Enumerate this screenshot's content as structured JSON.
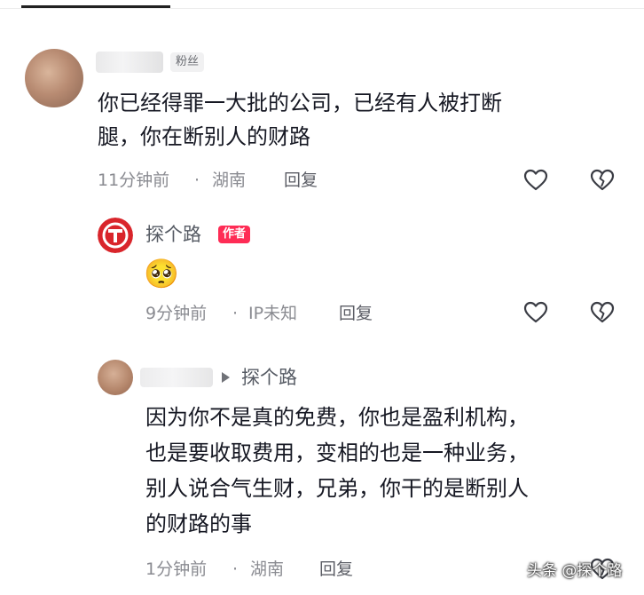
{
  "comments": [
    {
      "badge": "粉丝",
      "lines": [
        "你已经得罪一大批的公司，已经有人被打断",
        "腿，你在断别人的财路"
      ],
      "time": "11分钟前",
      "sep": "·",
      "location": "湖南",
      "reply": "回复"
    },
    {
      "name": "探个路",
      "badge": "作者",
      "emoji": "🥺",
      "time": "9分钟前",
      "sep": "·",
      "location": "IP未知",
      "reply": "回复"
    },
    {
      "reply_to": "探个路",
      "lines": [
        "因为你不是真的免费，你也是盈利机构，",
        "也是要收取费用，变相的也是一种业务，",
        "别人说合气生财，兄弟，你干的是断别人",
        "的财路的事"
      ],
      "time": "1分钟前",
      "sep": "·",
      "location": "湖南",
      "reply": "回复"
    }
  ],
  "watermark": "头条 @探个路",
  "colors": {
    "author_badge": "#fe2c55",
    "author_avatar": "#d9252b",
    "secondary_text": "#8a8b91"
  },
  "icons": [
    "like-heart-icon",
    "dislike-broken-heart-icon",
    "arrow-right-icon",
    "author-logo-icon"
  ]
}
